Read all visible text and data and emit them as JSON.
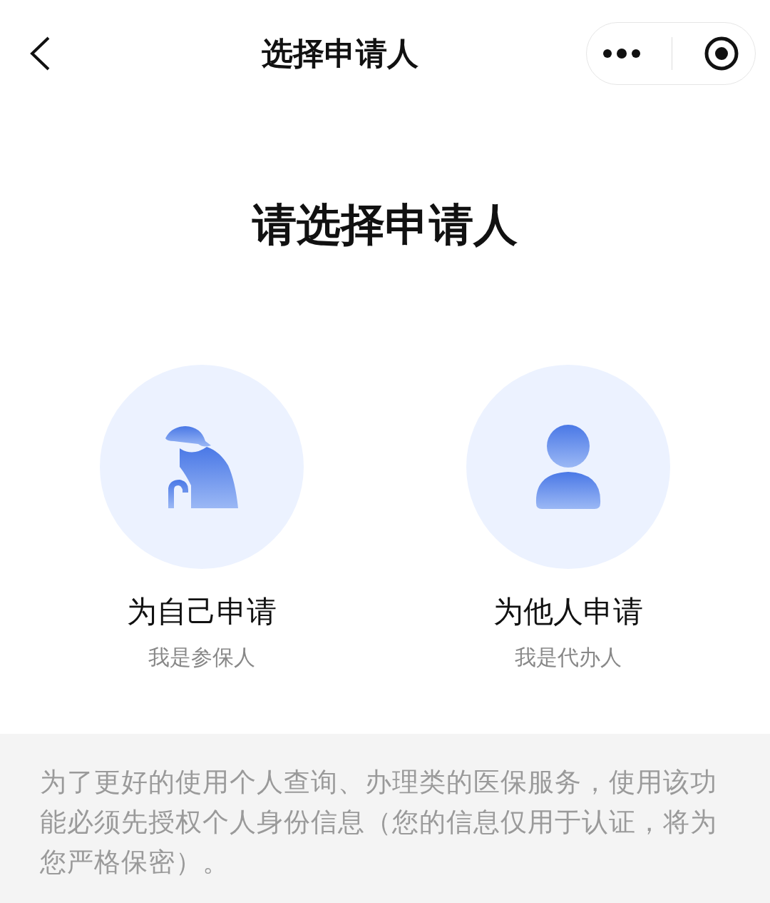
{
  "nav": {
    "title": "选择申请人"
  },
  "heading": "请选择申请人",
  "options": [
    {
      "kind": "elder",
      "title": "为自己申请",
      "subtitle": "我是参保人"
    },
    {
      "kind": "person",
      "title": "为他人申请",
      "subtitle": "我是代办人"
    }
  ],
  "notice": "为了更好的使用个人查询、办理类的医保服务，使用该功能必须先授权个人身份信息（您的信息仅用于认证，将为您严格保密）。"
}
